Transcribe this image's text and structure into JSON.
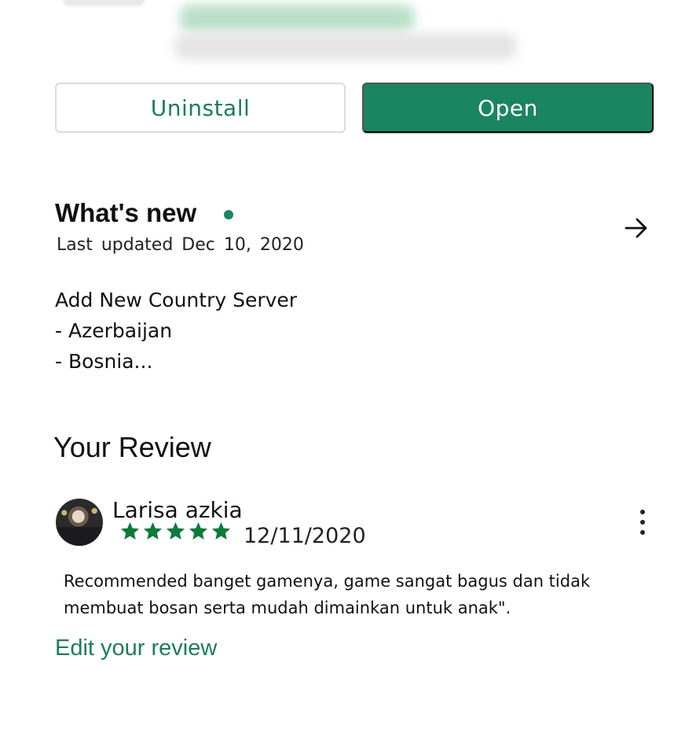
{
  "actions": {
    "uninstall_label": "Uninstall",
    "open_label": "Open"
  },
  "whats_new": {
    "title": "What's new",
    "last_updated": "Last updated  Dec 10, 2020",
    "notes": [
      "Add New Country Server",
      "- Azerbaijan",
      "- Bosnia..."
    ]
  },
  "review": {
    "section_title": "Your Review",
    "reviewer_name": "Larisa azkia",
    "rating": 5,
    "rating_max": 5,
    "date": "12/11/2020",
    "text_lines": [
      "Recommended banget gamenya, game sangat bagus dan tidak",
      "membuat bosan serta mudah dimainkan untuk anak\"."
    ],
    "edit_label": "Edit your review"
  },
  "icons": {
    "arrow": "arrow-right-icon",
    "more": "more-vert-icon",
    "star": "star-icon",
    "dot": "new-indicator-dot"
  },
  "colors": {
    "accent": "#1a8560",
    "accent_text": "#1b7d5a",
    "star": "#0d7a3a"
  }
}
